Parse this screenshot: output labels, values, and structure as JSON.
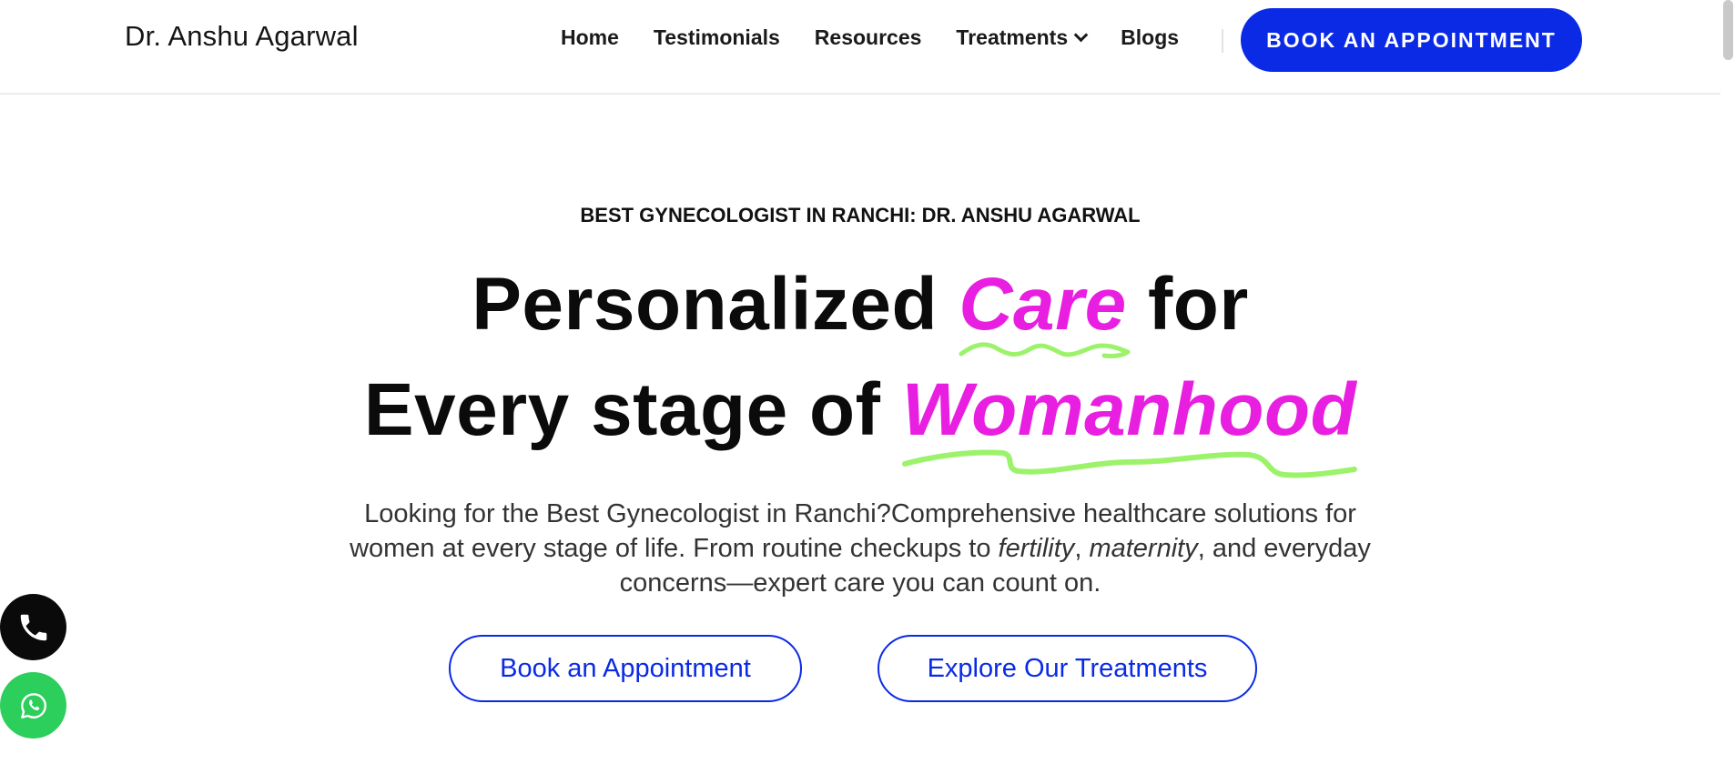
{
  "header": {
    "brand": "Dr. Anshu Agarwal",
    "nav": [
      {
        "label": "Home"
      },
      {
        "label": "Testimonials"
      },
      {
        "label": "Resources"
      },
      {
        "label": "Treatments",
        "has_dropdown": true
      },
      {
        "label": "Blogs"
      }
    ],
    "cta_label": "BOOK AN APPOINTMENT"
  },
  "hero": {
    "eyebrow": "BEST GYNECOLOGIST IN RANCHI: DR. ANSHU AGARWAL",
    "line1_prefix": "Personalized ",
    "line1_accent": "Care",
    "line1_suffix": " for",
    "line2_prefix": "Every stage of ",
    "line2_accent": "Womanhood",
    "description_part1": "Looking for the Best Gynecologist in Ranchi?Comprehensive healthcare solutions for women at every stage of life. From routine checkups to ",
    "description_em1": "fertility",
    "description_sep": ", ",
    "description_em2": "maternity",
    "description_part2": ", and everyday concerns—expert care you can count on.",
    "button_book": "Book an Appointment",
    "button_explore": "Explore Our Treatments"
  },
  "floating": {
    "phone_icon": "phone-icon",
    "whatsapp_icon": "whatsapp-icon"
  },
  "colors": {
    "primary_blue": "#0a2ae6",
    "accent_magenta": "#e81fe0",
    "squiggle_green": "#9cf36b",
    "whatsapp_green": "#2ccf5b",
    "phone_black": "#0a0a0a"
  }
}
